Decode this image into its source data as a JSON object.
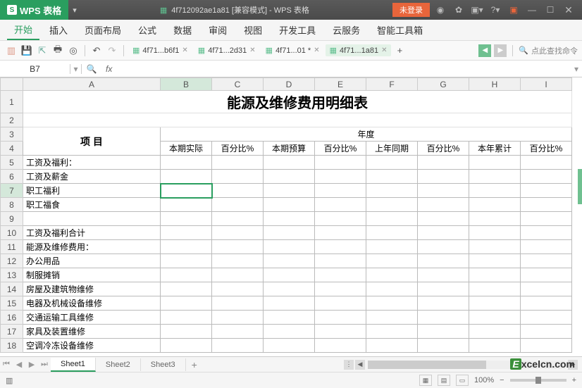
{
  "title": {
    "app_name": "WPS 表格",
    "doc_name": "4f712092ae1a81 [兼容模式] - WPS 表格",
    "login": "未登录"
  },
  "menus": [
    "开始",
    "插入",
    "页面布局",
    "公式",
    "数据",
    "审阅",
    "视图",
    "开发工具",
    "云服务",
    "智能工具箱"
  ],
  "toolbar": {
    "tabs": [
      {
        "label": "4f71...b6f1",
        "active": false
      },
      {
        "label": "4f71...2d31",
        "active": false
      },
      {
        "label": "4f71...01 *",
        "active": false
      },
      {
        "label": "4f71...1a81",
        "active": true
      }
    ],
    "search_placeholder": "点此查找命令"
  },
  "formula": {
    "cell_ref": "B7",
    "fx": "fx",
    "value": ""
  },
  "chart_data": {
    "type": "table",
    "title": "能源及维修费用明细表",
    "year_header": "年度",
    "row_header_label": "项   目",
    "columns": [
      "本期实际",
      "百分比%",
      "本期预算",
      "百分比%",
      "上年同期",
      "百分比%",
      "本年累计",
      "百分比%"
    ],
    "rows": [
      "工资及福利：",
      "  工资及薪金",
      "  职工福利",
      "  职工福食",
      "",
      "    工资及福利合计",
      "能源及维修费用：",
      "  办公用品",
      "  制服摊销",
      "  房屋及建筑物维修",
      "  电器及机械设备维修",
      "  交通运输工具维修",
      "  家具及装置维修",
      "  空调冷冻设备维修"
    ]
  },
  "columns": [
    "A",
    "B",
    "C",
    "D",
    "E",
    "F",
    "G",
    "H",
    "I"
  ],
  "row_numbers": [
    1,
    2,
    3,
    4,
    5,
    6,
    7,
    8,
    9,
    10,
    11,
    12,
    13,
    14,
    15,
    16,
    17,
    18
  ],
  "sheets": {
    "tabs": [
      "Sheet1",
      "Sheet2",
      "Sheet3"
    ],
    "active": 0
  },
  "status": {
    "zoom": "100%",
    "minus": "−",
    "plus": "+"
  },
  "watermark": {
    "e": "E",
    "text": "xcelcn.com"
  }
}
